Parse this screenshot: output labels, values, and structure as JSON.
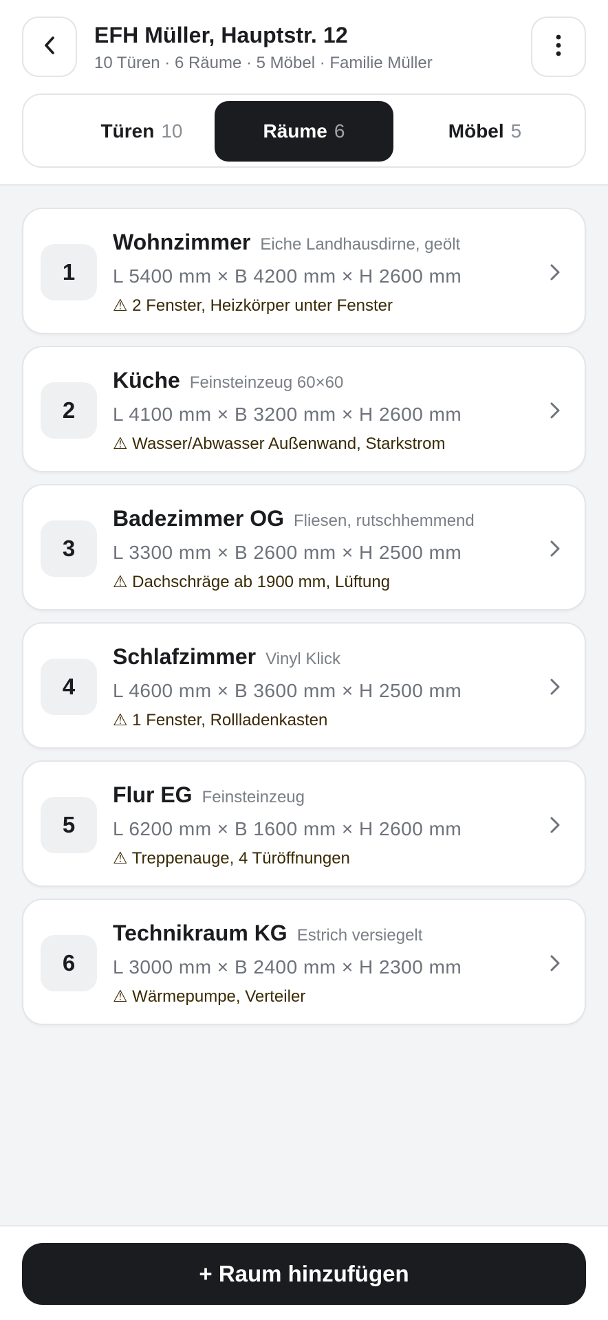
{
  "header": {
    "title": "EFH Müller, Hauptstr. 12",
    "subtitle": "10 Türen · 6 Räume · 5 Möbel · Familie Müller"
  },
  "tabs": [
    {
      "label": "Türen",
      "count": "10",
      "active": false
    },
    {
      "label": "Räume",
      "count": "6",
      "active": true
    },
    {
      "label": "Möbel",
      "count": "5",
      "active": false
    }
  ],
  "rooms": [
    {
      "number": "1",
      "name": "Wohnzimmer",
      "floor": "Eiche Landhausdirne, geölt",
      "dimensions": "L 5400 mm × B 4200 mm × H 2600 mm",
      "note": "⚠ 2 Fenster, Heizkörper unter Fenster"
    },
    {
      "number": "2",
      "name": "Küche",
      "floor": "Feinsteinzeug 60×60",
      "dimensions": "L 4100 mm × B 3200 mm × H 2600 mm",
      "note": "⚠ Wasser/Abwasser Außenwand, Starkstrom"
    },
    {
      "number": "3",
      "name": "Badezimmer OG",
      "floor": "Fliesen, rutschhemmend",
      "dimensions": "L 3300 mm × B 2600 mm × H 2500 mm",
      "note": "⚠ Dachschräge ab 1900 mm, Lüftung"
    },
    {
      "number": "4",
      "name": "Schlafzimmer",
      "floor": "Vinyl Klick",
      "dimensions": "L 4600 mm × B 3600 mm × H 2500 mm",
      "note": "⚠ 1 Fenster, Rollladenkasten"
    },
    {
      "number": "5",
      "name": "Flur EG",
      "floor": "Feinsteinzeug",
      "dimensions": "L 6200 mm × B 1600 mm × H 2600 mm",
      "note": "⚠ Treppenauge, 4 Türöffnungen"
    },
    {
      "number": "6",
      "name": "Technikraum KG",
      "floor": "Estrich versiegelt",
      "dimensions": "L 3000 mm × B 2400 mm × H 2300 mm",
      "note": "⚠ Wärmepumpe, Verteiler"
    }
  ],
  "actions": {
    "add_room_label": "+ Raum hinzufügen"
  },
  "icons": {
    "back": "chevron-left-icon",
    "more": "more-vertical-icon",
    "row": "chevron-right-icon"
  },
  "colors": {
    "primary": "#1b1c1f",
    "background": "#f3f4f6",
    "warning_text": "#3a2a05"
  }
}
